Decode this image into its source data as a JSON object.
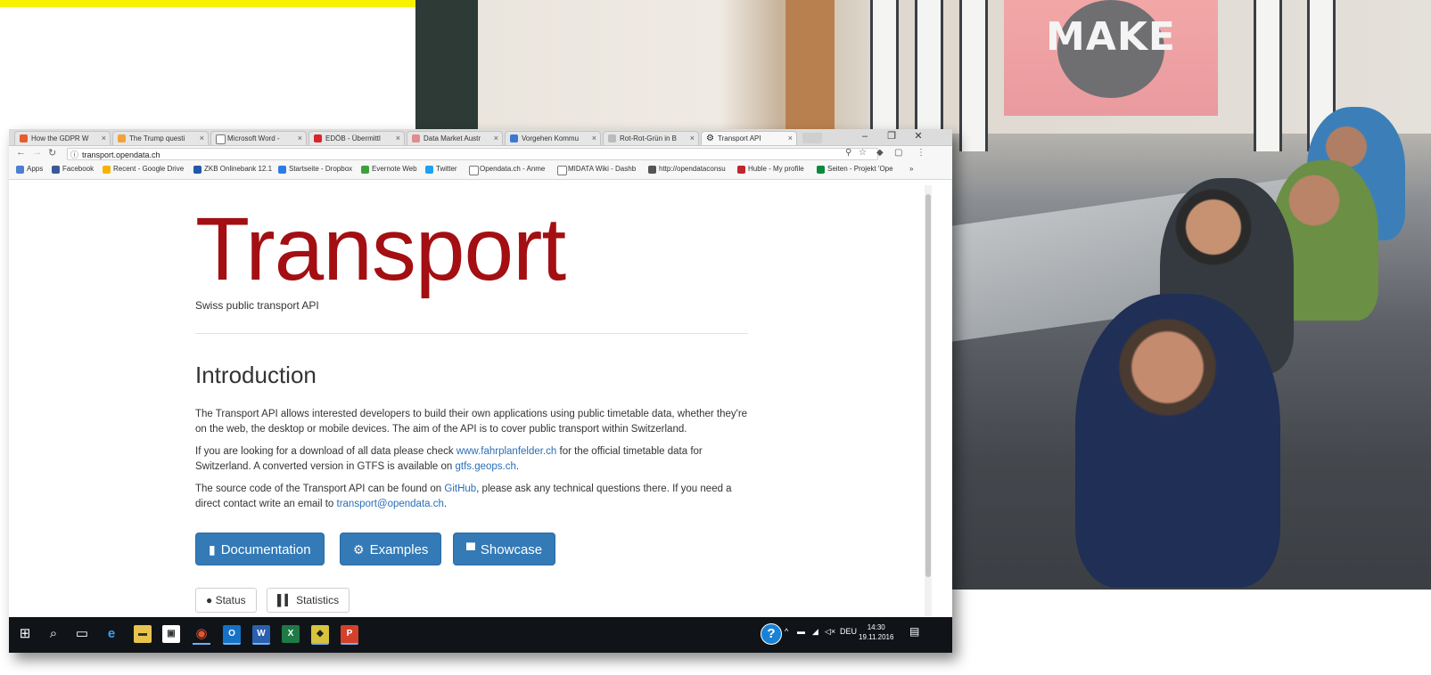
{
  "tabs": [
    {
      "label": "How the GDPR W",
      "color": "#e65c2e"
    },
    {
      "label": "The Trump questi",
      "color": "#f2a23a"
    },
    {
      "label": "Microsoft Word - ",
      "color": "#ffffff"
    },
    {
      "label": "EDÖB - Übermittl",
      "color": "#d9242b"
    },
    {
      "label": "Data Market Austr",
      "color": "#e08c8c"
    },
    {
      "label": "Vorgehen Kommu",
      "color": "#3b78d4"
    },
    {
      "label": "Rot-Rot-Grün in B",
      "color": "#bbbbbb"
    },
    {
      "label": "Transport API",
      "color": "#333333",
      "active": true
    }
  ],
  "window_controls": [
    "–",
    "❐",
    "✕"
  ],
  "url": "transport.opendata.ch",
  "bookmarks": [
    {
      "label": "Apps",
      "color": "#4a7fd3"
    },
    {
      "label": "Facebook",
      "color": "#3b5998"
    },
    {
      "label": "Recent - Google Drive",
      "color": "#f4b400"
    },
    {
      "label": "ZKB Onlinebank 12.1",
      "color": "#1f5aa8"
    },
    {
      "label": "Startseite - Dropbox",
      "color": "#2e7ce6"
    },
    {
      "label": "Evernote Web",
      "color": "#3da13a"
    },
    {
      "label": "Twitter",
      "color": "#1da1f2"
    },
    {
      "label": "Opendata.ch - Anme",
      "color": "#ffffff"
    },
    {
      "label": "MIDATA Wiki - Dashb",
      "color": "#ffffff"
    },
    {
      "label": "http://opendataconsu",
      "color": "#555555"
    },
    {
      "label": "Huble - My profile",
      "color": "#c0262c"
    },
    {
      "label": "Seiten - Projekt 'Ope",
      "color": "#0b8a3a"
    }
  ],
  "page": {
    "brand": "Transport",
    "tagline": "Swiss public transport API",
    "intro_heading": "Introduction",
    "p1": "The Transport API allows interested developers to build their own applications using public timetable data, whether they're on the web, the desktop or mobile devices. The aim of the API is to cover public transport within Switzerland.",
    "p2_before": "If you are looking for a download of all data please check ",
    "p2_link1": "www.fahrplanfelder.ch",
    "p2_mid": " for the official timetable data for Switzerland. A converted version in GTFS is available on ",
    "p2_link2": "gtfs.geops.ch",
    "p2_after": ".",
    "p3_before": "The source code of the Transport API can be found on ",
    "p3_link1": "GitHub",
    "p3_mid": ", please ask any technical questions there. If you need a direct contact write an email to ",
    "p3_link2": "transport@opendata.ch",
    "p3_after": ".",
    "btn_docs": "Documentation",
    "btn_examples": "Examples",
    "btn_showcase": "Showcase",
    "btn_status": "Status",
    "btn_stats": "Statistics"
  },
  "photo": {
    "screen_text": "MAKE"
  },
  "taskbar": {
    "lang": "DEU",
    "time": "14:30",
    "date": "19.11.2016"
  },
  "colors": {
    "brand_red": "#a30f12",
    "button_blue": "#337ab7",
    "link_blue": "#2a6fb7",
    "banner_yellow": "#f6f200"
  }
}
